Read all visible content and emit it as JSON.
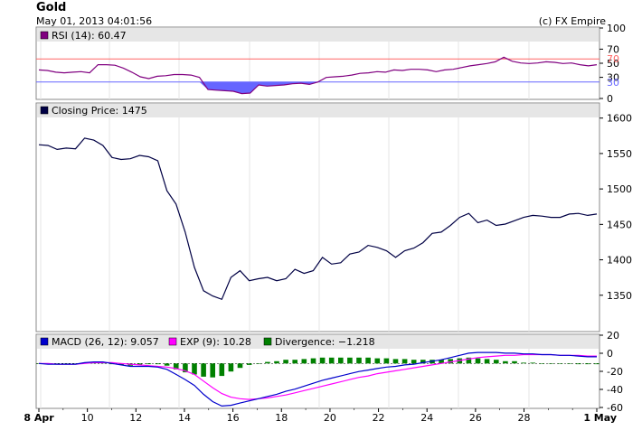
{
  "header": {
    "title": "Gold",
    "timestamp": "May 01, 2013 04:01:56",
    "credit": "(c) FX Empire"
  },
  "colors": {
    "rsi_line": "#800080",
    "rsi_fill": "#6666ff",
    "rsi_upper_line": "#ff6666",
    "rsi_lower_line": "#6666ff",
    "rsi_legend_box": "#800080",
    "price_line": "#000044",
    "price_legend_box": "#000044",
    "macd_line": "#0000cc",
    "exp_line": "#ff00ff",
    "divergence_bar": "#008000",
    "legend_bg": "#e6e6e6",
    "grid": "#e6e6e6"
  },
  "chart_data": [
    {
      "type": "line",
      "name": "rsi-panel",
      "legend": "RSI (14): 60.47",
      "ylim": [
        0,
        100
      ],
      "yticks": [
        0,
        30,
        50,
        70,
        100
      ],
      "reference_lines": [
        30,
        70
      ],
      "values": [
        51,
        50,
        47,
        46,
        47,
        48,
        46,
        60,
        60,
        59,
        54,
        47,
        39,
        36,
        40,
        41,
        43,
        43,
        42,
        38,
        17,
        16,
        15,
        14,
        10,
        11,
        25,
        23,
        24,
        25,
        27,
        28,
        26,
        30,
        38,
        39,
        40,
        42,
        45,
        46,
        48,
        47,
        51,
        50,
        52,
        52,
        51,
        48,
        51,
        52,
        55,
        58,
        60,
        62,
        65,
        73,
        66,
        63,
        62,
        63,
        65,
        64,
        62,
        63,
        60,
        58,
        60
      ]
    },
    {
      "type": "line",
      "name": "price-panel",
      "legend": "Closing Price: 1475",
      "ylim": [
        1300,
        1620
      ],
      "yticks": [
        1350,
        1400,
        1450,
        1500,
        1550,
        1600
      ],
      "values": [
        1579,
        1578,
        1572,
        1574,
        1573,
        1589,
        1586,
        1578,
        1560,
        1557,
        1558,
        1563,
        1561,
        1555,
        1510,
        1490,
        1448,
        1395,
        1360,
        1352,
        1347,
        1380,
        1390,
        1375,
        1378,
        1380,
        1375,
        1378,
        1392,
        1386,
        1390,
        1410,
        1400,
        1402,
        1415,
        1418,
        1428,
        1425,
        1420,
        1410,
        1420,
        1424,
        1432,
        1446,
        1448,
        1458,
        1470,
        1476,
        1462,
        1466,
        1458,
        1460,
        1465,
        1470,
        1473,
        1472,
        1470,
        1470,
        1475,
        1476,
        1473,
        1475
      ]
    },
    {
      "type": "line",
      "name": "macd-panel",
      "legend": [
        "MACD (26, 12): 9.057",
        "EXP (9): 10.28",
        "Divergence: −1.218"
      ],
      "ylim": [
        -60,
        20
      ],
      "yticks": [
        -60,
        -40,
        -20,
        0,
        20
      ],
      "series": [
        {
          "name": "MACD (26, 12): 9.057",
          "values": [
            0,
            -1,
            -1,
            -1,
            -1,
            1,
            2,
            2,
            0,
            -2,
            -4,
            -4,
            -4,
            -5,
            -8,
            -15,
            -22,
            -30,
            -42,
            -52,
            -58,
            -57,
            -54,
            -51,
            -48,
            -45,
            -42,
            -38,
            -35,
            -31,
            -27,
            -23,
            -20,
            -17,
            -14,
            -11,
            -9,
            -7,
            -5,
            -4,
            -2,
            -1,
            1,
            3,
            5,
            8,
            11,
            14,
            15,
            15,
            15,
            14,
            14,
            13,
            13,
            12,
            12,
            11,
            11,
            10,
            9,
            9
          ]
        },
        {
          "name": "EXP (9): 10.28",
          "values": [
            0,
            0,
            -1,
            -1,
            -1,
            0,
            1,
            1,
            1,
            0,
            -1,
            -2,
            -3,
            -4,
            -5,
            -7,
            -10,
            -15,
            -24,
            -33,
            -41,
            -46,
            -48,
            -49,
            -48,
            -47,
            -45,
            -43,
            -40,
            -37,
            -34,
            -31,
            -28,
            -25,
            -22,
            -19,
            -17,
            -14,
            -12,
            -10,
            -8,
            -6,
            -4,
            -2,
            0,
            2,
            4,
            6,
            8,
            9,
            10,
            11,
            11,
            12,
            12,
            12,
            12,
            11,
            11,
            11,
            10,
            10
          ]
        },
        {
          "name": "Divergence: −1.218",
          "type": "bar",
          "values": [
            0,
            -1,
            0,
            0,
            0,
            1,
            1,
            1,
            -1,
            -2,
            -3,
            -2,
            -1,
            -1,
            -3,
            -8,
            -12,
            -15,
            -18,
            -19,
            -17,
            -11,
            -6,
            -2,
            0,
            2,
            3,
            5,
            5,
            6,
            7,
            8,
            8,
            8,
            8,
            8,
            8,
            7,
            7,
            6,
            6,
            5,
            5,
            5,
            5,
            6,
            7,
            8,
            7,
            6,
            5,
            3,
            3,
            1,
            1,
            0,
            0,
            0,
            0,
            -1,
            -1,
            -1
          ]
        }
      ]
    }
  ],
  "x_axis": {
    "tick_labels": [
      "8 Apr",
      "10",
      "12",
      "14",
      "16",
      "18",
      "20",
      "22",
      "24",
      "26",
      "28",
      "1 May"
    ]
  }
}
